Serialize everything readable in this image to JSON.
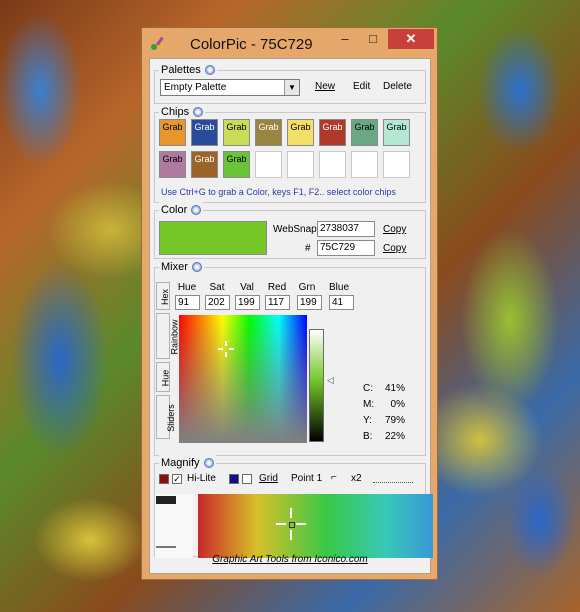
{
  "window": {
    "title": "ColorPic - 75C729",
    "min_glyph": "–",
    "max_glyph": "□",
    "close_glyph": "✕"
  },
  "palettes": {
    "label": "Palettes",
    "selected": "Empty Palette",
    "new_label": "New",
    "edit_label": "Edit",
    "delete_label": "Delete"
  },
  "chips": {
    "label": "Chips",
    "items": [
      {
        "label": "Grab",
        "color": "#e8962e"
      },
      {
        "label": "Grab",
        "color": "#2a4a9a"
      },
      {
        "label": "Grab",
        "color": "#c8dc5a"
      },
      {
        "label": "Grab",
        "color": "#9a8442"
      },
      {
        "label": "Grab",
        "color": "#f4e068"
      },
      {
        "label": "Grab",
        "color": "#b03a2a"
      },
      {
        "label": "Grab",
        "color": "#6aa884"
      },
      {
        "label": "Grab",
        "color": "#b4e8d4"
      },
      {
        "label": "Grab",
        "color": "#b07a9e"
      },
      {
        "label": "Grab",
        "color": "#9a6428"
      },
      {
        "label": "Grab",
        "color": "#6ac43a"
      }
    ],
    "hint": "Use Ctrl+G to grab a Color, keys F1, F2.. select color chips"
  },
  "color": {
    "label": "Color",
    "swatch": "#75C729",
    "websnap_label": "WebSnap",
    "websnap_value": "2738037",
    "hash_label": "#",
    "hex_value": "75C729",
    "copy_label": "Copy"
  },
  "mixer": {
    "label": "Mixer",
    "tabs": [
      "Hex",
      "Rainbow",
      "Hue",
      "Sliders"
    ],
    "headers": [
      "Hue",
      "Sat",
      "Val",
      "Red",
      "Grn",
      "Blue"
    ],
    "values": [
      "91",
      "202",
      "199",
      "117",
      "199",
      "41"
    ],
    "cmyk": [
      {
        "label": "C:",
        "value": "41%"
      },
      {
        "label": "M:",
        "value": "0%"
      },
      {
        "label": "Y:",
        "value": "79%"
      },
      {
        "label": "B:",
        "value": "22%"
      }
    ]
  },
  "magnify": {
    "label": "Magnify",
    "hilite_label": "Hi-Lite",
    "grid_label": "Grid",
    "point_label": "Point 1",
    "zoom_label": "x2",
    "hilite_color": "#8a1010",
    "grid_color": "#10108a"
  },
  "footer": "Graphic Art Tools from Iconico.com"
}
